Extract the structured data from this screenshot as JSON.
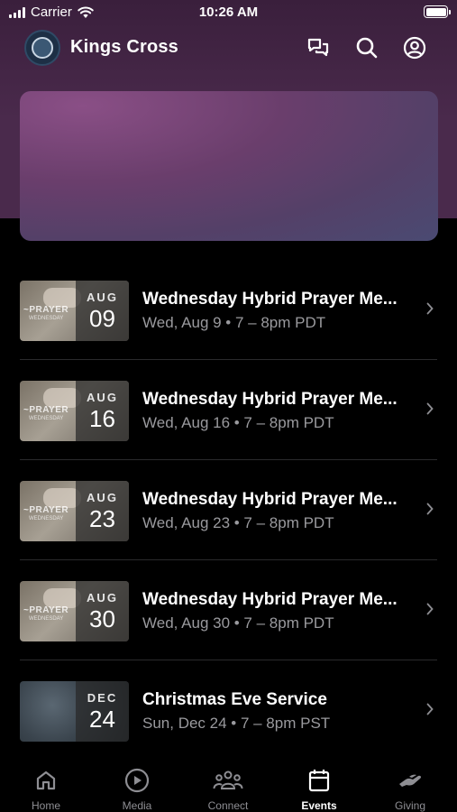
{
  "status_bar": {
    "carrier": "Carrier",
    "time": "10:26 AM"
  },
  "header": {
    "title": "Kings Cross"
  },
  "events": [
    {
      "month": "AUG",
      "day": "09",
      "title": "Wednesday Hybrid Prayer Me...",
      "subtitle": "Wed, Aug 9 • 7 – 8pm PDT",
      "thumb": "prayer"
    },
    {
      "month": "AUG",
      "day": "16",
      "title": "Wednesday Hybrid Prayer Me...",
      "subtitle": "Wed, Aug 16 • 7 – 8pm PDT",
      "thumb": "prayer"
    },
    {
      "month": "AUG",
      "day": "23",
      "title": "Wednesday Hybrid Prayer Me...",
      "subtitle": "Wed, Aug 23 • 7 – 8pm PDT",
      "thumb": "prayer"
    },
    {
      "month": "AUG",
      "day": "30",
      "title": "Wednesday Hybrid Prayer Me...",
      "subtitle": "Wed, Aug 30 • 7 – 8pm PDT",
      "thumb": "prayer"
    },
    {
      "month": "DEC",
      "day": "24",
      "title": "Christmas Eve Service",
      "subtitle": "Sun, Dec 24 • 7 – 8pm PST",
      "thumb": "winter"
    }
  ],
  "tabs": [
    {
      "label": "Home",
      "icon": "home-icon",
      "active": false
    },
    {
      "label": "Media",
      "icon": "play-icon",
      "active": false
    },
    {
      "label": "Connect",
      "icon": "people-icon",
      "active": false
    },
    {
      "label": "Events",
      "icon": "calendar-icon",
      "active": true
    },
    {
      "label": "Giving",
      "icon": "hand-icon",
      "active": false
    }
  ],
  "colors": {
    "header_bg": "#3a1f3c",
    "background": "#000000",
    "muted_text": "#9a9a9e",
    "tab_inactive": "#8e8e93"
  }
}
